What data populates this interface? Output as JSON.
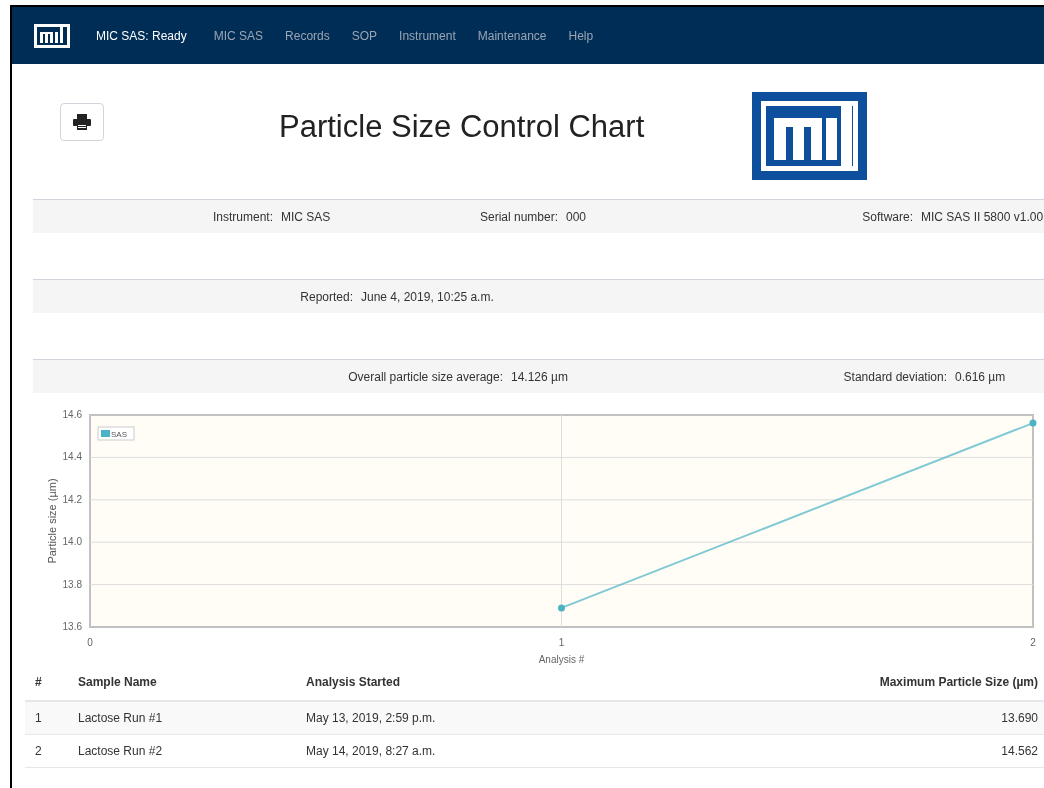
{
  "navbar": {
    "brand": "MIC SAS: Ready",
    "items": [
      {
        "label": "MIC SAS"
      },
      {
        "label": "Records"
      },
      {
        "label": "SOP"
      },
      {
        "label": "Instrument"
      },
      {
        "label": "Maintenance"
      },
      {
        "label": "Help"
      }
    ]
  },
  "title": "Particle Size Control Chart",
  "info_rows": [
    [
      {
        "label": "Instrument:",
        "value": "MIC SAS"
      },
      {
        "label": "Serial number:",
        "value": "000"
      },
      {
        "label": "Software:",
        "value": "MIC SAS II 5800 v1.00"
      }
    ],
    [
      {
        "label": "Reported:",
        "value": "June 4, 2019, 10:25 a.m."
      }
    ],
    [
      {
        "label": "Overall particle size average:",
        "value": "14.126 µm"
      },
      {
        "label": "Standard deviation:",
        "value": "0.616 µm"
      }
    ]
  ],
  "chart": {
    "chart_data": {
      "type": "line",
      "grid": true,
      "xlabel": "Analysis #",
      "ylabel": "Particle size (µm)",
      "x": [
        1,
        2
      ],
      "series": [
        {
          "name": "SAS",
          "color": "#4ab3c6",
          "marker": true,
          "values": [
            13.69,
            14.562
          ]
        }
      ],
      "xlim": [
        0,
        2
      ],
      "ylim": [
        13.6,
        14.6
      ],
      "xticks": [
        0,
        1,
        2
      ],
      "yticks": [
        {
          "value": 13.6,
          "label": "13.6"
        },
        {
          "value": 13.8,
          "label": "13.8"
        },
        {
          "value": 14.0,
          "label": "14.0"
        },
        {
          "value": 14.2,
          "label": "14.2"
        },
        {
          "value": 14.4,
          "label": "14.4"
        },
        {
          "value": 14.6,
          "label": "14.6"
        }
      ]
    }
  },
  "table": {
    "columns": [
      "#",
      "Sample Name",
      "Analysis Started",
      "Maximum Particle Size (µm)"
    ],
    "rows": [
      [
        "1",
        "Lactose Run #1",
        "May 13, 2019, 2:59 p.m.",
        "13.690"
      ],
      [
        "2",
        "Lactose Run #2",
        "May 14, 2019, 8:27 a.m.",
        "14.562"
      ]
    ]
  }
}
